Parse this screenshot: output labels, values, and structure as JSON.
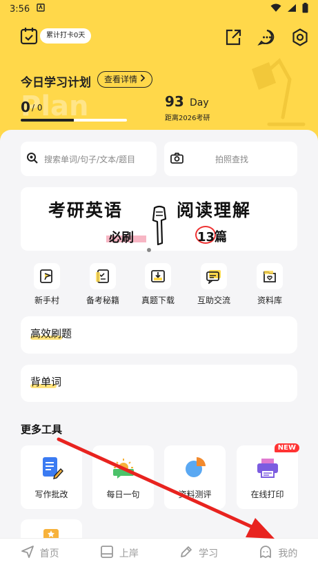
{
  "status_bar": {
    "time": "3:56"
  },
  "header": {
    "checkin_badge": "累计打卡0天",
    "plan_title": "今日学习计划",
    "detail_button": "查看详情",
    "plan_watermark": "Plan",
    "progress": {
      "done": "0",
      "total": "/ 0",
      "fraction": 0.5
    },
    "countdown": {
      "days": "93",
      "unit": "Day",
      "label": "距离2026考研"
    }
  },
  "search": {
    "placeholder": "搜索单词/句子/文本/题目",
    "photo_label": "拍照查找"
  },
  "banner": {
    "line1": "考研英语",
    "line2": "阅读理解",
    "line3": "必刷",
    "line4": "13篇"
  },
  "quick_links": [
    {
      "label": "新手村",
      "icon": "flag-icon"
    },
    {
      "label": "备考秘籍",
      "icon": "checklist-book-icon"
    },
    {
      "label": "真题下载",
      "icon": "download-tray-icon"
    },
    {
      "label": "互助交流",
      "icon": "chat-icon"
    },
    {
      "label": "资料库",
      "icon": "folder-heart-icon"
    }
  ],
  "sections": [
    {
      "title": "高效刷题"
    },
    {
      "title": "背单词"
    }
  ],
  "more_tools": {
    "title": "更多工具",
    "items": [
      {
        "label": "写作批改",
        "icon": "writing-correction-icon"
      },
      {
        "label": "每日一句",
        "icon": "sunrise-chat-icon"
      },
      {
        "label": "资料测评",
        "icon": "pie-chart-icon"
      },
      {
        "label": "在线打印",
        "icon": "printer-icon",
        "badge": "NEW"
      }
    ]
  },
  "bottom_nav": [
    {
      "label": "首页",
      "icon": "send-icon"
    },
    {
      "label": "上岸",
      "icon": "book-icon"
    },
    {
      "label": "学习",
      "icon": "pen-icon"
    },
    {
      "label": "我的",
      "icon": "ghost-profile-icon"
    }
  ],
  "colors": {
    "brand_yellow": "#FFD84A",
    "panel_bg": "#F5F5F7",
    "annotation_red": "#E8231F",
    "badge_red": "#FF3333"
  }
}
